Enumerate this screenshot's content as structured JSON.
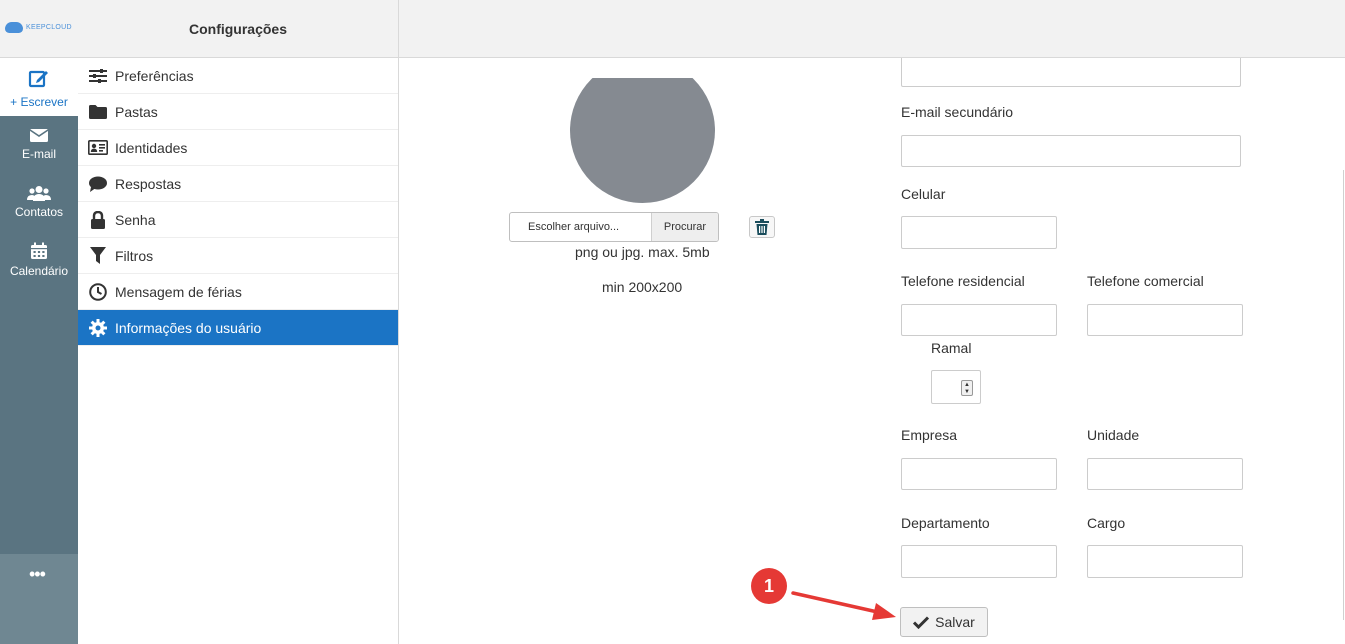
{
  "brand": {
    "logo_text": "KEEPCLOUD"
  },
  "rail": {
    "compose_label": "+ Escrever",
    "items": [
      {
        "label": "E-mail",
        "icon": "envelope-icon"
      },
      {
        "label": "Contatos",
        "icon": "users-icon"
      },
      {
        "label": "Calendário",
        "icon": "calendar-icon"
      }
    ],
    "more_label": "•••"
  },
  "settings": {
    "title": "Configurações",
    "items": [
      {
        "label": "Preferências",
        "icon": "sliders-icon"
      },
      {
        "label": "Pastas",
        "icon": "folder-icon"
      },
      {
        "label": "Identidades",
        "icon": "id-card-icon"
      },
      {
        "label": "Respostas",
        "icon": "comment-icon"
      },
      {
        "label": "Senha",
        "icon": "lock-icon"
      },
      {
        "label": "Filtros",
        "icon": "filter-icon"
      },
      {
        "label": "Mensagem de férias",
        "icon": "clock-icon"
      },
      {
        "label": "Informações do usuário",
        "icon": "gear-icon",
        "active": true
      }
    ]
  },
  "photo": {
    "file_placeholder": "Escolher arquivo...",
    "browse_label": "Procurar",
    "hint_format": "png ou jpg. max. 5mb",
    "hint_size": "min 200x200"
  },
  "form": {
    "secondary_email_label": "E-mail secundário",
    "mobile_label": "Celular",
    "home_phone_label": "Telefone residencial",
    "work_phone_label": "Telefone comercial",
    "extension_label": "Ramal",
    "company_label": "Empresa",
    "unit_label": "Unidade",
    "department_label": "Departamento",
    "role_label": "Cargo",
    "save_label": "Salvar"
  },
  "annotation": {
    "step_number": "1"
  },
  "colors": {
    "accent": "#1b74c5",
    "rail": "#5a7481",
    "badge": "#e53935"
  }
}
